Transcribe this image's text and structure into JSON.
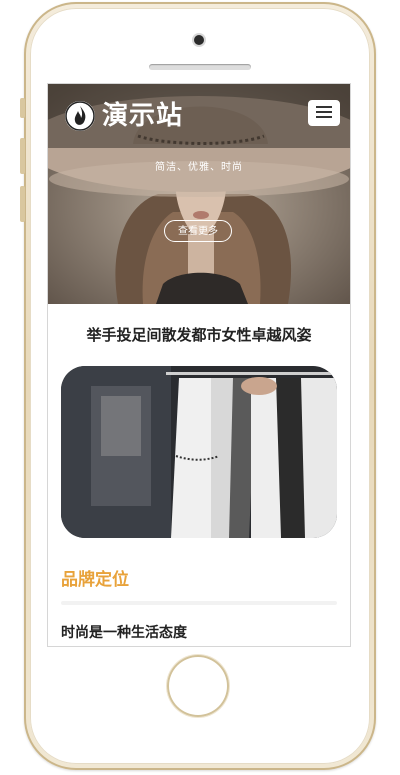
{
  "header": {
    "logo_text": "演示站",
    "logo_icon": "flame-logo-icon",
    "menu_icon": "hamburger-menu-icon"
  },
  "hero": {
    "tagline": "简洁、优雅、时尚",
    "more_button": "查看更多"
  },
  "content": {
    "headline": "举手投足间散发都市女性卓越风姿",
    "brand_section_title": "品牌定位",
    "brand_subtitle": "时尚是一种生活态度"
  },
  "colors": {
    "accent": "#e8a23a",
    "text": "#222222"
  }
}
